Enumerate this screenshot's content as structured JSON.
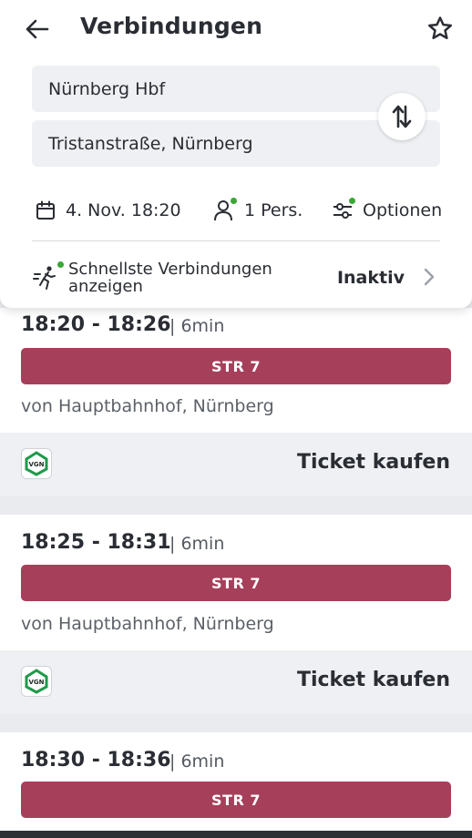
{
  "header": {
    "title": "Verbindungen",
    "from": "Nürnberg Hbf",
    "to": "Tristanstraße, Nürnberg",
    "date_label": "4. Nov. 18:20",
    "persons_label": "1 Pers.",
    "options_label": "Optionen",
    "fast_label": "Schnellste Verbindungen anzeigen",
    "fast_status": "Inaktiv"
  },
  "connections": [
    {
      "time": "18:20 - 18:26",
      "duration": "| 6min",
      "line": "STR 7",
      "from": "von Hauptbahnhof, Nürnberg",
      "ticket": "Ticket kaufen"
    },
    {
      "time": "18:25 - 18:31",
      "duration": "| 6min",
      "line": "STR 7",
      "from": "von Hauptbahnhof, Nürnberg",
      "ticket": "Ticket kaufen"
    },
    {
      "time": "18:30 - 18:36",
      "duration": "| 6min",
      "line": "STR 7"
    }
  ],
  "logo_text": "VGN",
  "colors": {
    "line": "#a6405a",
    "accent_dot": "#3aa637",
    "vgn_green": "#1f9a4a"
  }
}
